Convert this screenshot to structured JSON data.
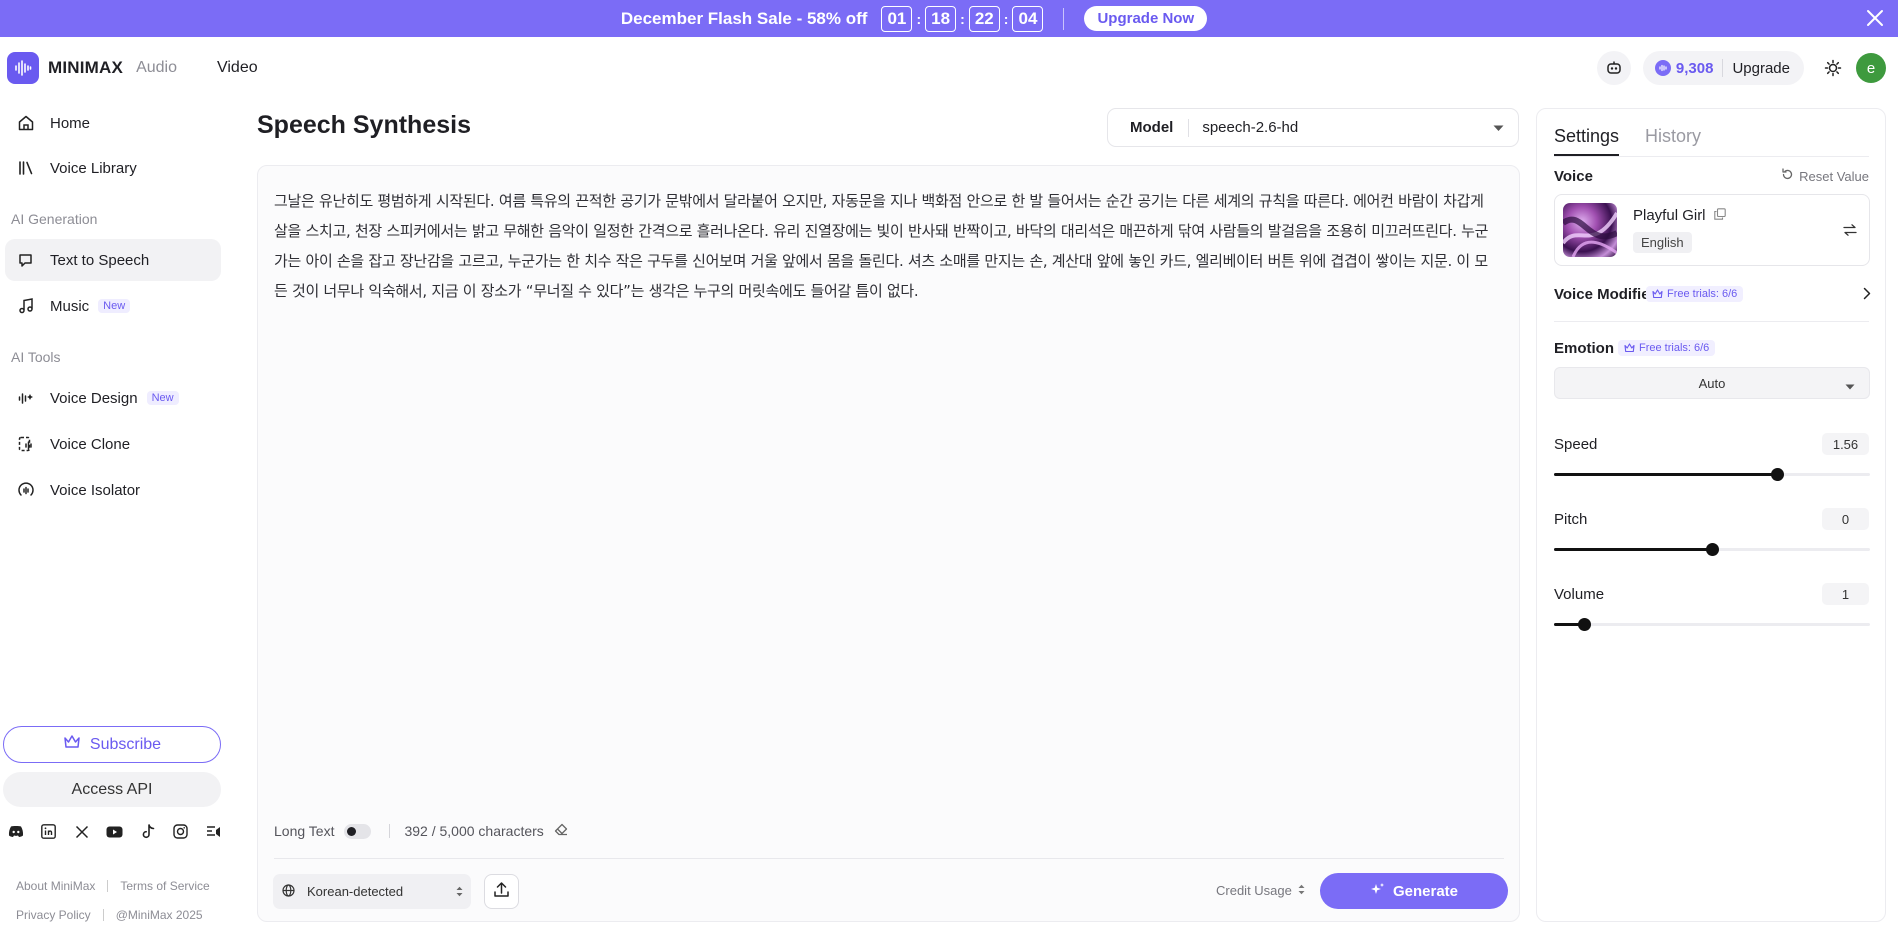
{
  "banner": {
    "title": "December Flash Sale - 58% off",
    "timer": [
      "01",
      "18",
      "22",
      "04"
    ],
    "timer_separator": ":",
    "upgrade_label": "Upgrade Now",
    "bg_color": "#7b6cf6"
  },
  "header": {
    "brand": "MINIMAX",
    "nav_audio": "Audio",
    "nav_video": "Video",
    "credits": "9,308",
    "upgrade_label": "Upgrade",
    "avatar_initial": "e",
    "icons": [
      "robot-icon",
      "credit-icon",
      "sun-icon"
    ]
  },
  "sidebar": {
    "home": "Home",
    "voice_library": "Voice Library",
    "section_ai_generation": "AI Generation",
    "text_to_speech": "Text to Speech",
    "music": "Music",
    "music_badge": "New",
    "section_ai_tools": "AI Tools",
    "voice_design": "Voice Design",
    "voice_design_badge": "New",
    "voice_clone": "Voice Clone",
    "voice_isolator": "Voice Isolator",
    "subscribe": "Subscribe",
    "access_api": "Access API",
    "socials": [
      "discord-icon",
      "linkedin-icon",
      "x-icon",
      "youtube-icon",
      "tiktok-icon",
      "instagram-icon",
      "feishu-icon"
    ],
    "footer": {
      "about": "About MiniMax",
      "terms": "Terms of Service",
      "privacy": "Privacy Policy",
      "copyright": "@MiniMax 2025"
    }
  },
  "main": {
    "title": "Speech Synthesis",
    "model_label": "Model",
    "model_value": "speech-2.6-hd",
    "text": "그날은 유난히도 평범하게 시작된다. 여름 특유의 끈적한 공기가 문밖에서 달라붙어 오지만, 자동문을 지나 백화점 안으로 한 발 들어서는 순간 공기는 다른 세계의 규칙을 따른다. 에어컨 바람이 차갑게 살을 스치고, 천장 스피커에서는 밝고 무해한 음악이 일정한 간격으로 흘러나온다. 유리 진열장에는 빛이 반사돼 반짝이고, 바닥의 대리석은 매끈하게 닦여 사람들의 발걸음을 조용히 미끄러뜨린다. 누군가는 아이 손을 잡고 장난감을 고르고, 누군가는 한 치수 작은 구두를 신어보며 거울 앞에서 몸을 돌린다. 셔츠 소매를 만지는 손, 계산대 앞에 놓인 카드, 엘리베이터 버튼 위에 겹겹이 쌓이는 지문. 이 모든 것이 너무나 익숙해서, 지금 이 장소가 “무너질 수 있다”는 생각은 누구의 머릿속에도 들어갈 틈이 없다.",
    "long_text_label": "Long Text",
    "char_count": "392 / 5,000 characters",
    "language": "Korean-detected",
    "credit_usage": "Credit Usage",
    "generate": "Generate"
  },
  "settings": {
    "tab_settings": "Settings",
    "tab_history": "History",
    "voice_label": "Voice",
    "reset_value": "Reset Value",
    "voice_name": "Playful Girl",
    "voice_language": "English",
    "voice_modifier_label": "Voice Modifier",
    "voice_modifier_trials": "Free trials: 6/6",
    "emotion_label": "Emotion",
    "emotion_trials": "Free trials: 6/6",
    "emotion_value": "Auto",
    "speed_label": "Speed",
    "speed_value": "1.56",
    "speed_fraction": 0.705,
    "pitch_label": "Pitch",
    "pitch_value": "0",
    "pitch_fraction": 0.5,
    "volume_label": "Volume",
    "volume_value": "1",
    "volume_fraction": 0.095,
    "accent_color": "#6a5af0"
  }
}
